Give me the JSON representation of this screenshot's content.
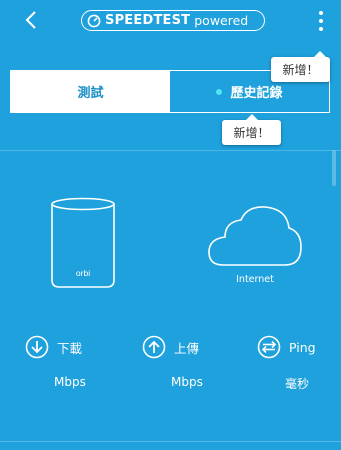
{
  "header": {
    "brand_name": "SPEEDTEST",
    "brand_suffix": "powered",
    "back_icon": "chevron-left-icon",
    "menu_icon": "more-vertical-icon"
  },
  "tooltips": {
    "menu_new": "新增！",
    "history_new": "新增！"
  },
  "tabs": [
    {
      "label": "測試",
      "selected": true
    },
    {
      "label": "歷史記錄",
      "selected": false,
      "indicator_color": "#4ee6f5"
    }
  ],
  "diagram": {
    "router_text": "orbi",
    "internet_label": "Internet"
  },
  "stats": {
    "download": {
      "label": "下載",
      "unit": "Mbps",
      "icon": "download-arrow-icon"
    },
    "upload": {
      "label": "上傳",
      "unit": "Mbps",
      "icon": "upload-arrow-icon"
    },
    "ping": {
      "label": "Ping",
      "unit": "毫秒",
      "icon": "ping-arrows-icon"
    }
  },
  "colors": {
    "background": "#1ea1dc",
    "active_tab_text": "#1a8fc8",
    "foreground": "#ffffff"
  }
}
